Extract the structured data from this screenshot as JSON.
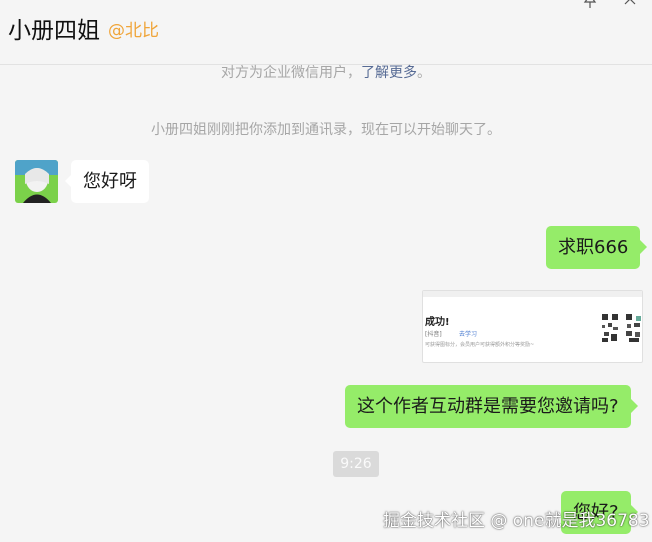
{
  "header": {
    "title": "小册四姐",
    "tag": "@北比"
  },
  "icons": {
    "pin": "pin-icon",
    "close": "close-icon"
  },
  "system_messages": {
    "notice_text": "对方为企业微信用户，",
    "notice_link": "了解更多",
    "notice_end": "。",
    "added_text": "小册四姐刚刚把你添加到通讯录，现在可以开始聊天了。"
  },
  "messages": [
    {
      "side": "in",
      "text": "您好呀"
    },
    {
      "side": "out",
      "text": "求职666"
    },
    {
      "side": "out",
      "type": "image",
      "image": {
        "heading": "成功!",
        "line1": "[抖音]",
        "line2": "去学习",
        "line3": "可获得图标分，会员用户可获得额外积分等奖励~"
      }
    },
    {
      "side": "out",
      "text": "这个作者互动群是需要您邀请吗?"
    },
    {
      "side": "out",
      "text": "您好?"
    }
  ],
  "timestamp": "9:26",
  "watermark": "掘金技术社区 @ one就是我36783",
  "colors": {
    "outgoing_bubble": "#95ec69",
    "incoming_bubble": "#ffffff",
    "link": "#576b95",
    "tag": "#f0a53a",
    "background": "#f5f5f5"
  }
}
